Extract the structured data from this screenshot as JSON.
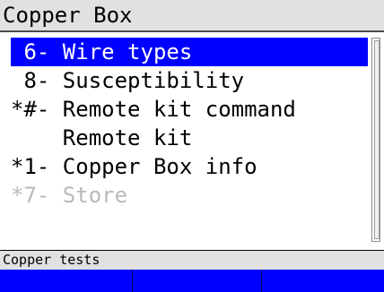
{
  "window": {
    "title": "Copper Box"
  },
  "menu": {
    "items": [
      {
        "label": " 6- Wire types",
        "state": "selected"
      },
      {
        "label": " 8- Susceptibility",
        "state": "normal"
      },
      {
        "label": "*#- Remote kit command",
        "state": "normal"
      },
      {
        "label": "    Remote kit",
        "state": "normal"
      },
      {
        "label": "*1- Copper Box info",
        "state": "normal"
      },
      {
        "label": "*7- Store",
        "state": "disabled"
      }
    ]
  },
  "status": {
    "text": "Copper tests"
  },
  "softkeys": [
    {
      "label": ""
    },
    {
      "label": ""
    },
    {
      "label": ""
    }
  ],
  "colors": {
    "selection": "#0000ff",
    "softkey_bar": "#0000ff",
    "title_bg": "#e1e1e1",
    "disabled_text": "#b9b9b9"
  }
}
